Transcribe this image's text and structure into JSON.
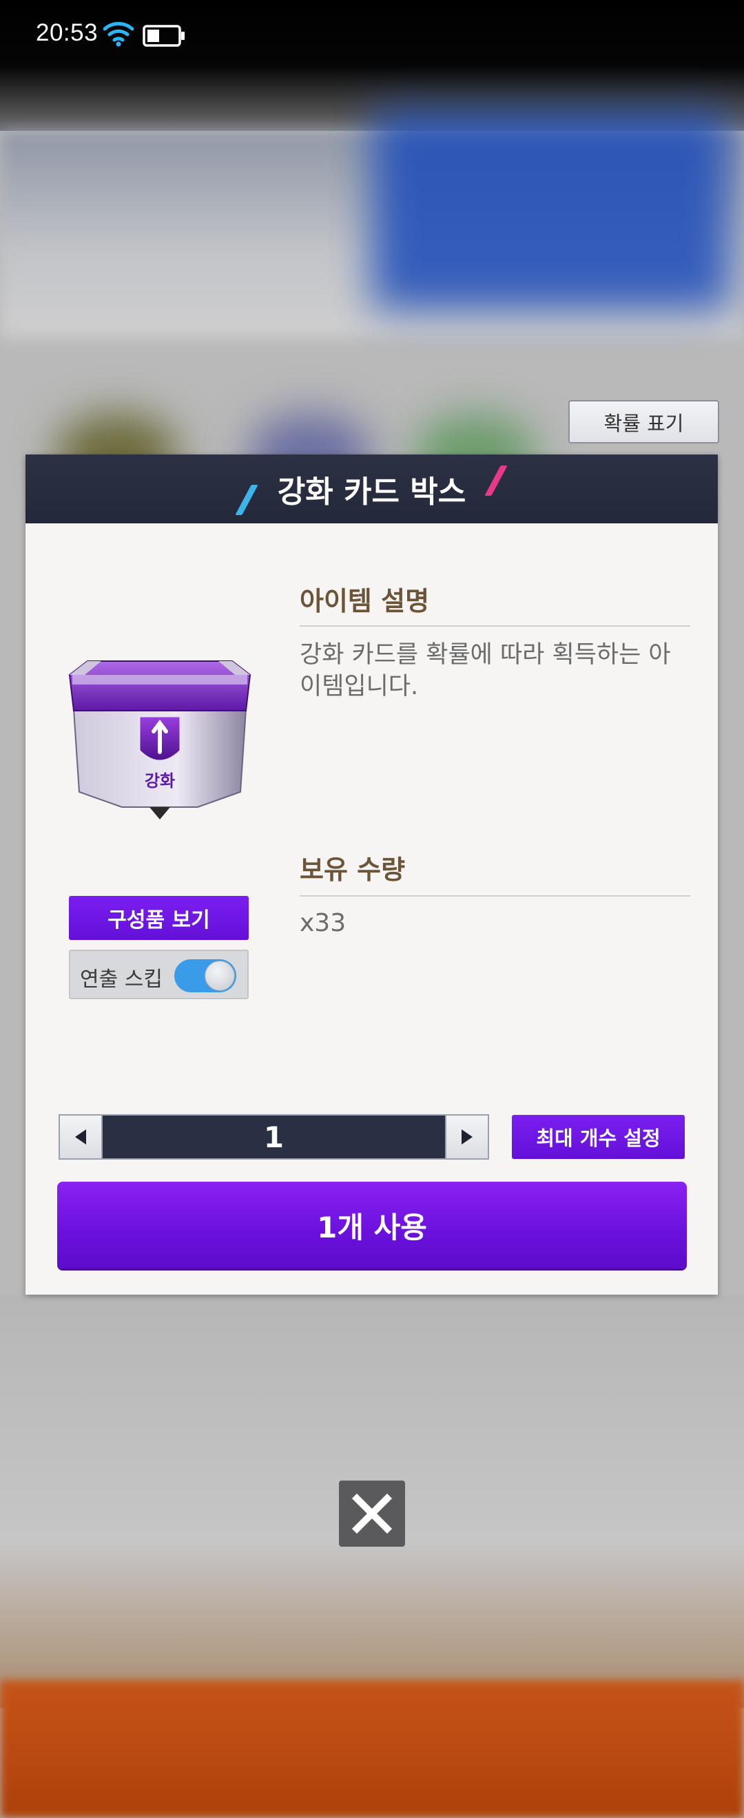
{
  "status_bar": {
    "time": "20:53"
  },
  "probability_button": {
    "label": "확률 표기"
  },
  "modal": {
    "title": "강화 카드 박스",
    "item_image_label": "강화",
    "description_heading": "아이템 설명",
    "description_text": "강화 카드를 확률에 따라 획득하는 아이템입니다.",
    "quantity_heading": "보유 수량",
    "quantity_value": "x33",
    "components_button": "구성품 보기",
    "skip_animation_label": "연출 스킵",
    "skip_animation_on": true,
    "stepper_value": "1",
    "max_count_button": "최대 개수 설정",
    "use_button": "1개 사용"
  },
  "colors": {
    "header_bg": "#262b3d",
    "accent_purple": "#6a10dc",
    "toggle_blue": "#3a9ce8",
    "heading_brown": "#6c5438"
  },
  "icons": [
    "wifi-icon",
    "battery-icon",
    "decrement-arrow-icon",
    "increment-arrow-icon",
    "close-icon"
  ]
}
